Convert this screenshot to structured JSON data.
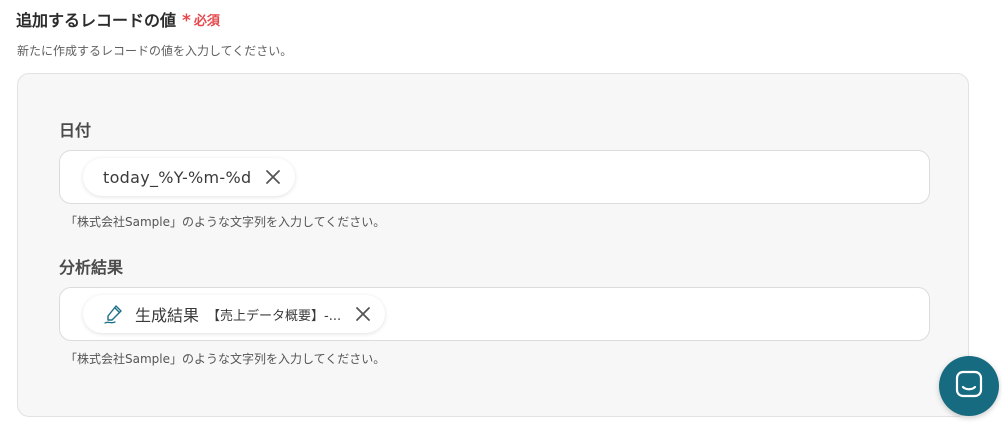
{
  "section": {
    "title": "追加するレコードの値",
    "required_asterisk": "*",
    "required_label": "必須",
    "description": "新たに作成するレコードの値を入力してください。"
  },
  "fields": [
    {
      "label": "日付",
      "chip": {
        "text": "today_%Y-%m-%d",
        "remove_icon": "close-icon"
      },
      "hint": "「株式会社Sample」のような文字列を入力してください。"
    },
    {
      "label": "分析結果",
      "chip": {
        "icon": "pen-icon",
        "main": "生成結果",
        "sub": "【売上データ概要】-...",
        "remove_icon": "close-icon"
      },
      "hint": "「株式会社Sample」のような文字列を入力してください。"
    }
  ],
  "chat_launcher": {
    "icon": "chat-icon",
    "color": "#176b80"
  },
  "colors": {
    "required": "#e5484d",
    "panel_bg": "#f7f7f7",
    "accent": "#176b80"
  }
}
